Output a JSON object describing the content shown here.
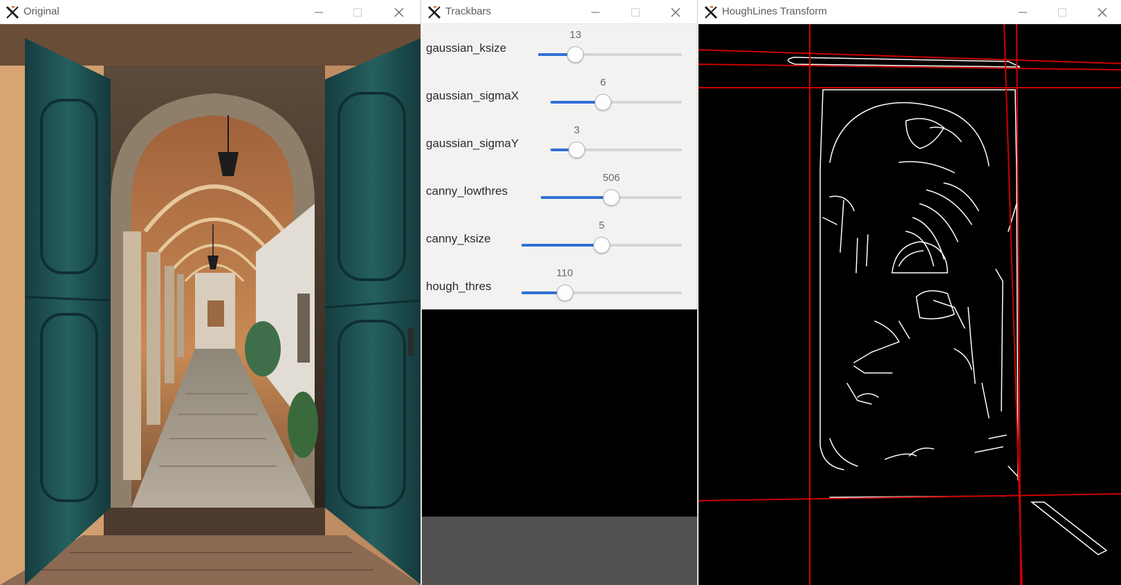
{
  "windows": {
    "original": {
      "title": "Original",
      "icon": "x-app-icon",
      "controls": [
        "minimize-icon",
        "maximize-icon",
        "close-icon"
      ]
    },
    "trackbars": {
      "title": "Trackbars",
      "icon": "x-app-icon",
      "controls": [
        "minimize-icon",
        "maximize-icon",
        "close-icon"
      ],
      "sliders": [
        {
          "label": "gaussian_ksize",
          "value": "13",
          "fraction": 0.26
        },
        {
          "label": "gaussian_sigmaX",
          "value": "6",
          "fraction": 0.4
        },
        {
          "label": "gaussian_sigmaY",
          "value": "3",
          "fraction": 0.2
        },
        {
          "label": "canny_lowthres",
          "value": "506",
          "fraction": 0.5
        },
        {
          "label": "canny_ksize",
          "value": "5",
          "fraction": 0.5
        },
        {
          "label": "hough_thres",
          "value": "110",
          "fraction": 0.27
        }
      ]
    },
    "hough": {
      "title": "HoughLines Transform",
      "icon": "x-app-icon",
      "controls": [
        "minimize-icon",
        "maximize-icon",
        "close-icon"
      ]
    }
  },
  "colors": {
    "slider_fill": "#2f6fd6",
    "door_teal": "#1f5a5c",
    "hough_line": "#cc0000",
    "edge": "#ffffff"
  }
}
